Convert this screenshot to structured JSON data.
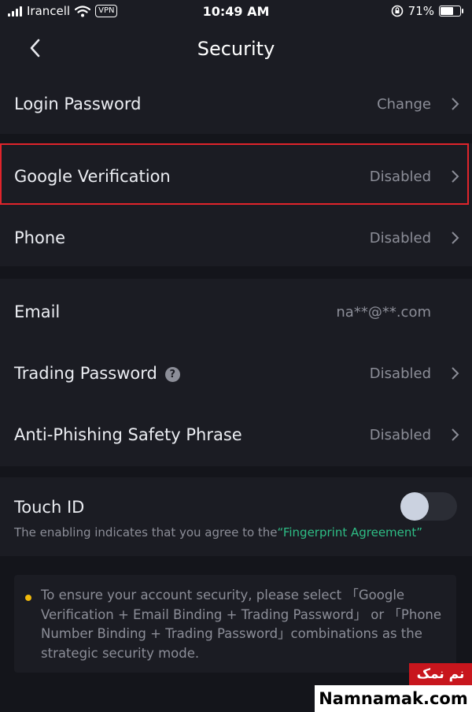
{
  "status_bar": {
    "carrier": "Irancell",
    "vpn_label": "VPN",
    "time": "10:49 AM",
    "battery_text": "71%",
    "battery_level": 0.71
  },
  "nav": {
    "title": "Security",
    "back_icon": "chevron-left-icon"
  },
  "rows": {
    "login_password": {
      "label": "Login Password",
      "value": "Change"
    },
    "google_verification": {
      "label": "Google Verification",
      "value": "Disabled"
    },
    "phone": {
      "label": "Phone",
      "value": "Disabled"
    },
    "email": {
      "label": "Email",
      "value": "na**@**.com"
    },
    "trading_password": {
      "label": "Trading Password",
      "value": "Disabled",
      "help_icon": "?"
    },
    "anti_phishing": {
      "label": "Anti-Phishing Safety Phrase",
      "value": "Disabled"
    }
  },
  "touch_id": {
    "label": "Touch ID",
    "description": "The enabling indicates that you agree to the",
    "agreement_link": "“Fingerprint Agreement”",
    "enabled": false
  },
  "notice": {
    "text": "To ensure your account security, please select 「Google Verification + Email Binding + Trading Password」 or 「Phone Number Binding + Trading Password」combinations as the strategic security mode."
  },
  "watermark": {
    "top": "نم نمک",
    "bottom": "Namnamak.com"
  },
  "colors": {
    "background": "#14151b",
    "surface": "#1b1c23",
    "text_primary": "#eceef3",
    "text_secondary": "#8c8e98",
    "link_green": "#2ebd85",
    "bullet_yellow": "#f0b90b",
    "highlight_red": "#e0242b"
  }
}
